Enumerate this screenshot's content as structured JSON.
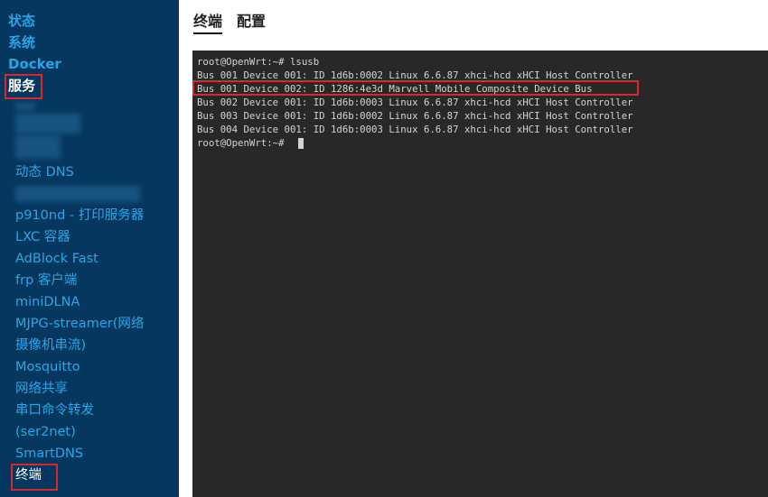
{
  "sidebar": {
    "top_items": [
      {
        "label": "状态"
      },
      {
        "label": "系统"
      },
      {
        "label": "Docker"
      },
      {
        "label": "服务"
      }
    ],
    "services": [
      {
        "label": "动态 DNS"
      },
      {
        "label": "p910nd - 打印服务器"
      },
      {
        "label": "LXC 容器"
      },
      {
        "label": "AdBlock Fast"
      },
      {
        "label": "frp 客户端"
      },
      {
        "label": "miniDLNA"
      },
      {
        "label": "MJPG-streamer(网络"
      },
      {
        "label": "摄像机串流)"
      },
      {
        "label": "Mosquitto"
      },
      {
        "label": "网络共享"
      },
      {
        "label": "串口命令转发"
      },
      {
        "label": "(ser2net)"
      },
      {
        "label": "SmartDNS"
      },
      {
        "label": "终端"
      }
    ]
  },
  "tabs": [
    {
      "label": "终端"
    },
    {
      "label": "配置"
    }
  ],
  "terminal": {
    "lines": [
      "root@OpenWrt:~# lsusb",
      "Bus 001 Device 001: ID 1d6b:0002 Linux 6.6.87 xhci-hcd xHCI Host Controller",
      "Bus 001 Device 002: ID 1286:4e3d Marvell Mobile Composite Device Bus",
      "Bus 002 Device 001: ID 1d6b:0003 Linux 6.6.87 xhci-hcd xHCI Host Controller",
      "Bus 003 Device 001: ID 1d6b:0002 Linux 6.6.87 xhci-hcd xHCI Host Controller",
      "Bus 004 Device 001: ID 1d6b:0003 Linux 6.6.87 xhci-hcd xHCI Host Controller",
      "root@OpenWrt:~# "
    ]
  },
  "colors": {
    "sidebar_bg": "#06375e",
    "link": "#2ba6e8",
    "highlight": "#d8282e",
    "terminal_bg": "#282828"
  }
}
